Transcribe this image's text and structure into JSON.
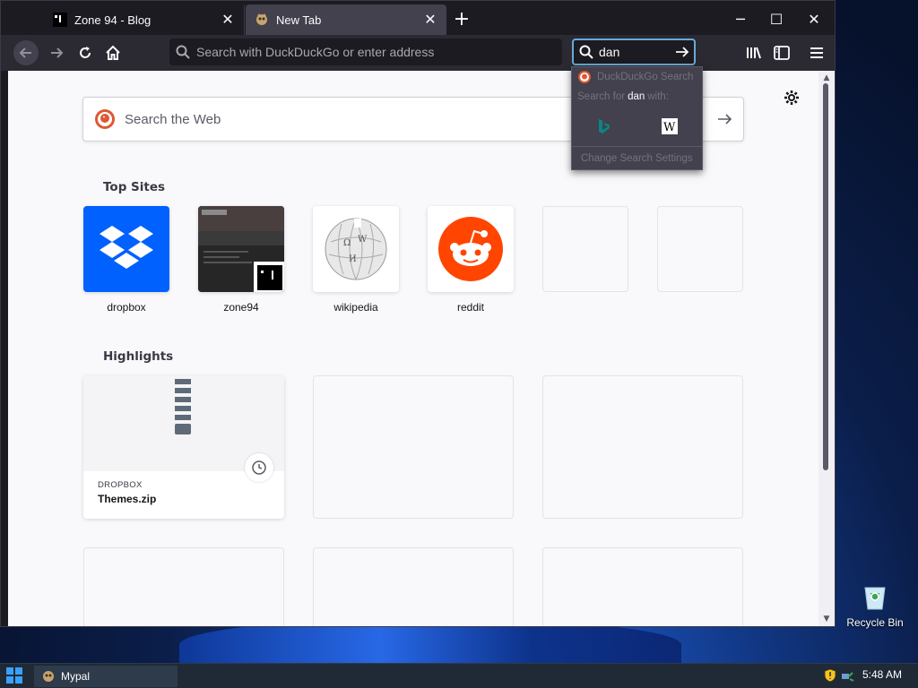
{
  "window": {
    "tabs": [
      {
        "title": "Zone 94 - Blog",
        "active": false,
        "favicon": "zone94-favicon-icon"
      },
      {
        "title": "New Tab",
        "active": true,
        "favicon": "mypal-favicon-icon"
      }
    ],
    "new_tab_symbol": "+",
    "controls": {
      "minimize": "─",
      "maximize": "☐",
      "close": "✕"
    }
  },
  "navbar": {
    "url_placeholder": "Search with DuckDuckGo or enter address",
    "search_value": "dan"
  },
  "newtab": {
    "web_search_placeholder": "Search the Web",
    "top_sites_title": "Top Sites",
    "top_sites": [
      {
        "label": "dropbox",
        "icon": "dropbox-logo-icon",
        "color": "#0061fe"
      },
      {
        "label": "zone94",
        "icon": "zone94-thumbnail"
      },
      {
        "label": "wikipedia",
        "icon": "wikipedia-globe-icon"
      },
      {
        "label": "reddit",
        "icon": "reddit-alien-icon",
        "color": "#ff4500"
      },
      {
        "label": "",
        "icon": ""
      },
      {
        "label": "",
        "icon": ""
      }
    ],
    "highlights_title": "Highlights",
    "highlight_card": {
      "source": "DROPBOX",
      "filename": "Themes.zip"
    }
  },
  "search_popup": {
    "engine_row": "DuckDuckGo Search",
    "search_for_prefix": "Search for",
    "search_for_query": "dan",
    "search_for_suffix": "with:",
    "engines": [
      "bing-icon",
      "wikipedia-w-icon"
    ],
    "settings_label": "Change Search Settings"
  },
  "desktop": {
    "recycle_bin_label": "Recycle Bin"
  },
  "taskbar": {
    "task_label": "Mypal",
    "time": "5:48 AM"
  },
  "colors": {
    "accent_focus": "#6aa9d8",
    "toolbar": "#2b2a33",
    "content_bg": "#f9f9fb"
  }
}
